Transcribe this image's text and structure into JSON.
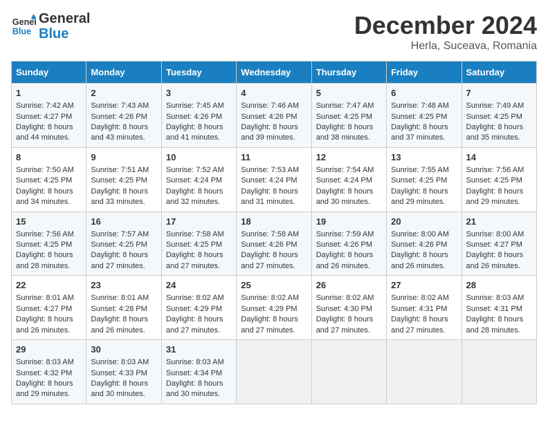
{
  "header": {
    "logo_line1": "General",
    "logo_line2": "Blue",
    "main_title": "December 2024",
    "subtitle": "Herla, Suceava, Romania"
  },
  "weekdays": [
    "Sunday",
    "Monday",
    "Tuesday",
    "Wednesday",
    "Thursday",
    "Friday",
    "Saturday"
  ],
  "weeks": [
    [
      {
        "day": "1",
        "sunrise": "7:42 AM",
        "sunset": "4:27 PM",
        "daylight": "8 hours and 44 minutes."
      },
      {
        "day": "2",
        "sunrise": "7:43 AM",
        "sunset": "4:26 PM",
        "daylight": "8 hours and 43 minutes."
      },
      {
        "day": "3",
        "sunrise": "7:45 AM",
        "sunset": "4:26 PM",
        "daylight": "8 hours and 41 minutes."
      },
      {
        "day": "4",
        "sunrise": "7:46 AM",
        "sunset": "4:26 PM",
        "daylight": "8 hours and 39 minutes."
      },
      {
        "day": "5",
        "sunrise": "7:47 AM",
        "sunset": "4:25 PM",
        "daylight": "8 hours and 38 minutes."
      },
      {
        "day": "6",
        "sunrise": "7:48 AM",
        "sunset": "4:25 PM",
        "daylight": "8 hours and 37 minutes."
      },
      {
        "day": "7",
        "sunrise": "7:49 AM",
        "sunset": "4:25 PM",
        "daylight": "8 hours and 35 minutes."
      }
    ],
    [
      {
        "day": "8",
        "sunrise": "7:50 AM",
        "sunset": "4:25 PM",
        "daylight": "8 hours and 34 minutes."
      },
      {
        "day": "9",
        "sunrise": "7:51 AM",
        "sunset": "4:25 PM",
        "daylight": "8 hours and 33 minutes."
      },
      {
        "day": "10",
        "sunrise": "7:52 AM",
        "sunset": "4:24 PM",
        "daylight": "8 hours and 32 minutes."
      },
      {
        "day": "11",
        "sunrise": "7:53 AM",
        "sunset": "4:24 PM",
        "daylight": "8 hours and 31 minutes."
      },
      {
        "day": "12",
        "sunrise": "7:54 AM",
        "sunset": "4:24 PM",
        "daylight": "8 hours and 30 minutes."
      },
      {
        "day": "13",
        "sunrise": "7:55 AM",
        "sunset": "4:25 PM",
        "daylight": "8 hours and 29 minutes."
      },
      {
        "day": "14",
        "sunrise": "7:56 AM",
        "sunset": "4:25 PM",
        "daylight": "8 hours and 29 minutes."
      }
    ],
    [
      {
        "day": "15",
        "sunrise": "7:56 AM",
        "sunset": "4:25 PM",
        "daylight": "8 hours and 28 minutes."
      },
      {
        "day": "16",
        "sunrise": "7:57 AM",
        "sunset": "4:25 PM",
        "daylight": "8 hours and 27 minutes."
      },
      {
        "day": "17",
        "sunrise": "7:58 AM",
        "sunset": "4:25 PM",
        "daylight": "8 hours and 27 minutes."
      },
      {
        "day": "18",
        "sunrise": "7:58 AM",
        "sunset": "4:26 PM",
        "daylight": "8 hours and 27 minutes."
      },
      {
        "day": "19",
        "sunrise": "7:59 AM",
        "sunset": "4:26 PM",
        "daylight": "8 hours and 26 minutes."
      },
      {
        "day": "20",
        "sunrise": "8:00 AM",
        "sunset": "4:26 PM",
        "daylight": "8 hours and 26 minutes."
      },
      {
        "day": "21",
        "sunrise": "8:00 AM",
        "sunset": "4:27 PM",
        "daylight": "8 hours and 26 minutes."
      }
    ],
    [
      {
        "day": "22",
        "sunrise": "8:01 AM",
        "sunset": "4:27 PM",
        "daylight": "8 hours and 26 minutes."
      },
      {
        "day": "23",
        "sunrise": "8:01 AM",
        "sunset": "4:28 PM",
        "daylight": "8 hours and 26 minutes."
      },
      {
        "day": "24",
        "sunrise": "8:02 AM",
        "sunset": "4:29 PM",
        "daylight": "8 hours and 27 minutes."
      },
      {
        "day": "25",
        "sunrise": "8:02 AM",
        "sunset": "4:29 PM",
        "daylight": "8 hours and 27 minutes."
      },
      {
        "day": "26",
        "sunrise": "8:02 AM",
        "sunset": "4:30 PM",
        "daylight": "8 hours and 27 minutes."
      },
      {
        "day": "27",
        "sunrise": "8:02 AM",
        "sunset": "4:31 PM",
        "daylight": "8 hours and 27 minutes."
      },
      {
        "day": "28",
        "sunrise": "8:03 AM",
        "sunset": "4:31 PM",
        "daylight": "8 hours and 28 minutes."
      }
    ],
    [
      {
        "day": "29",
        "sunrise": "8:03 AM",
        "sunset": "4:32 PM",
        "daylight": "8 hours and 29 minutes."
      },
      {
        "day": "30",
        "sunrise": "8:03 AM",
        "sunset": "4:33 PM",
        "daylight": "8 hours and 30 minutes."
      },
      {
        "day": "31",
        "sunrise": "8:03 AM",
        "sunset": "4:34 PM",
        "daylight": "8 hours and 30 minutes."
      },
      null,
      null,
      null,
      null
    ]
  ],
  "labels": {
    "sunrise": "Sunrise:",
    "sunset": "Sunset:",
    "daylight": "Daylight:"
  }
}
